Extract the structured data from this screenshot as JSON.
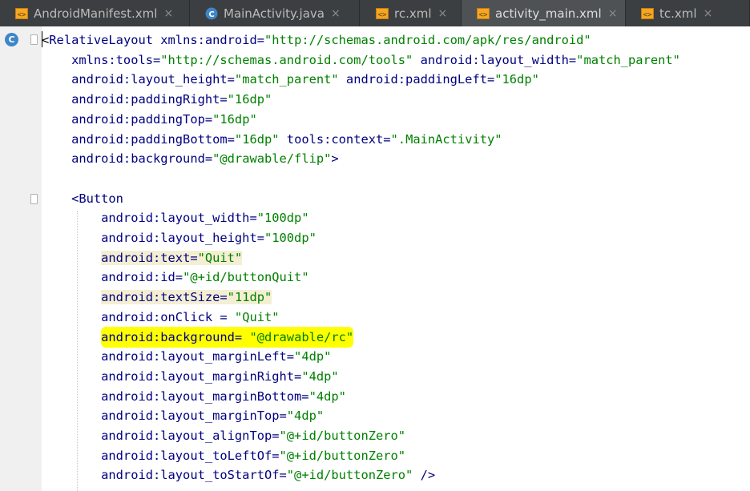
{
  "tabs": [
    {
      "label": "AndroidManifest.xml",
      "icon": "xml-file-icon",
      "active": false
    },
    {
      "label": "MainActivity.java",
      "icon": "java-class-icon",
      "active": false
    },
    {
      "label": "rc.xml",
      "icon": "xml-file-icon",
      "active": false
    },
    {
      "label": "activity_main.xml",
      "icon": "xml-file-icon",
      "active": true
    },
    {
      "label": "tc.xml",
      "icon": "xml-file-icon",
      "active": false
    }
  ],
  "tab_close_glyph": "×",
  "gutter": {
    "class_badge": "C"
  },
  "colors": {
    "tag": "#000080",
    "attribute_value": "#008000",
    "search_highlight": "#ffff00",
    "usage_highlight": "#f4efd3",
    "tab_bar": "#3c3f41"
  },
  "code": {
    "lines": [
      "<RelativeLayout xmlns:android=\"http://schemas.android.com/apk/res/android\"",
      "    xmlns:tools=\"http://schemas.android.com/tools\" android:layout_width=\"match_parent\"",
      "    android:layout_height=\"match_parent\" android:paddingLeft=\"16dp\"",
      "    android:paddingRight=\"16dp\"",
      "    android:paddingTop=\"16dp\"",
      "    android:paddingBottom=\"16dp\" tools:context=\".MainActivity\"",
      "    android:background=\"@drawable/flip\">",
      "",
      "    <Button",
      "        android:layout_width=\"100dp\"",
      "        android:layout_height=\"100dp\"",
      "        android:text=\"Quit\"",
      "        android:id=\"@+id/buttonQuit\"",
      "        android:textSize=\"11dp\"",
      "        android:onClick = \"Quit\"",
      "        android:background= \"@drawable/rc\"",
      "        android:layout_marginLeft=\"4dp\"",
      "        android:layout_marginRight=\"4dp\"",
      "        android:layout_marginBottom=\"4dp\"",
      "        android:layout_marginTop=\"4dp\"",
      "        android:layout_alignTop=\"@+id/buttonZero\"",
      "        android:layout_toLeftOf=\"@+id/buttonZero\"",
      "        android:layout_toStartOf=\"@+id/buttonZero\" />"
    ]
  }
}
